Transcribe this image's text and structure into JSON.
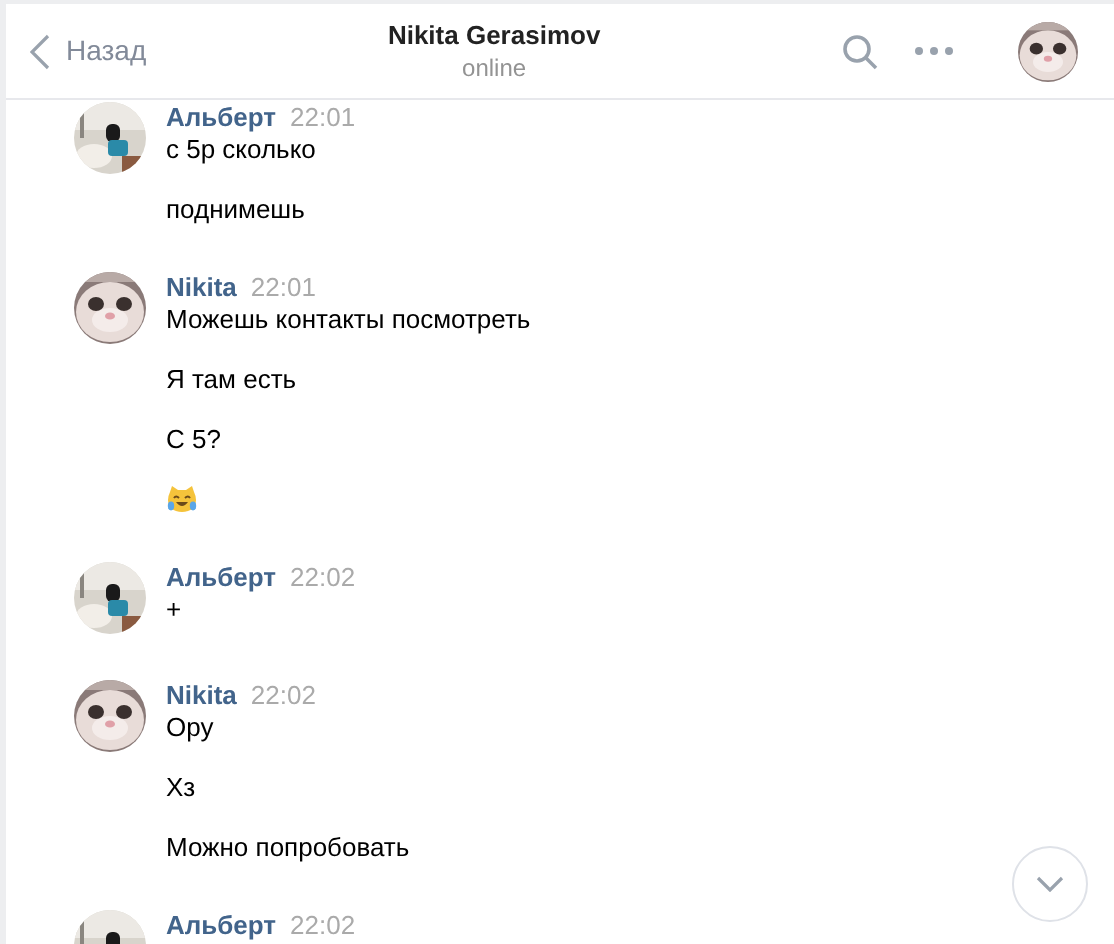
{
  "header": {
    "back": "Назад",
    "title": "Nikita Gerasimov",
    "status": "online"
  },
  "messages": [
    {
      "author": "Альберт",
      "kind": "other",
      "time": "22:01",
      "lines": [
        {
          "kind": "text",
          "text": "с 5р сколько"
        },
        {
          "kind": "text",
          "text": "поднимешь"
        }
      ]
    },
    {
      "author": "Nikita",
      "kind": "self",
      "time": "22:01",
      "lines": [
        {
          "kind": "text",
          "text": "Можешь контакты посмотреть"
        },
        {
          "kind": "text",
          "text": "Я там есть"
        },
        {
          "kind": "text",
          "text": "С 5?"
        },
        {
          "kind": "emoji"
        }
      ]
    },
    {
      "author": "Альберт",
      "kind": "other",
      "time": "22:02",
      "lines": [
        {
          "kind": "text",
          "text": "+"
        }
      ]
    },
    {
      "author": "Nikita",
      "kind": "self",
      "time": "22:02",
      "lines": [
        {
          "kind": "text",
          "text": "Ору"
        },
        {
          "kind": "text",
          "text": "Хз"
        },
        {
          "kind": "text",
          "text": "Можно попробовать"
        }
      ]
    },
    {
      "author": "Альберт",
      "kind": "other",
      "time": "22:02"
    }
  ]
}
